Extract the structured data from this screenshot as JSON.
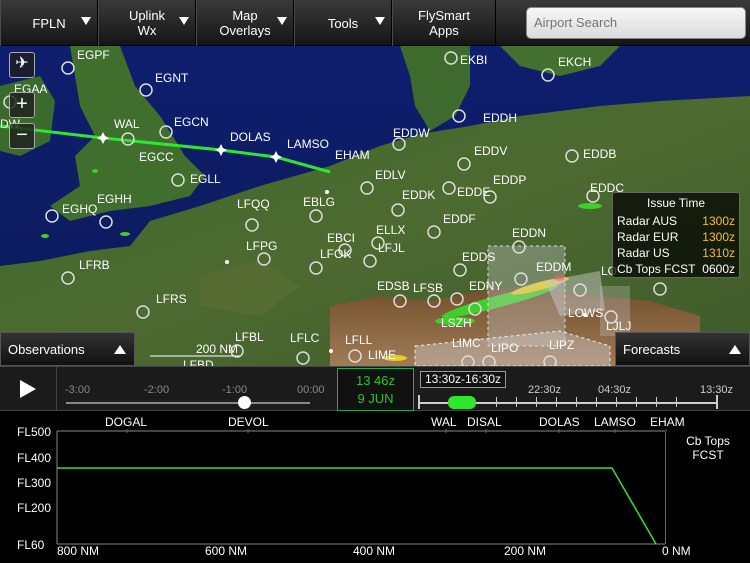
{
  "toolbar": {
    "fpln": "FPLN",
    "uplink_line1": "Uplink",
    "uplink_line2": "Wx",
    "overlays_line1": "Map",
    "overlays_line2": "Overlays",
    "tools": "Tools",
    "flysmart_line1": "FlySmart",
    "flysmart_line2": "Apps",
    "search_placeholder": "Airport Search"
  },
  "map": {
    "scale": "200 NM",
    "route_waypoints": [
      "WAL",
      "DOLAS",
      "LAMSO",
      "EHAM"
    ],
    "airports": [
      "EGPF",
      "EGNT",
      "EGAA",
      "EKBI",
      "EKCH",
      "EGCN",
      "EGCC",
      "EGLL",
      "EGHH",
      "EGHQ",
      "EDDW",
      "EDDH",
      "EDDV",
      "EDDB",
      "EDLV",
      "EDDP",
      "EDDC",
      "EDDK",
      "EDDE",
      "EDDF",
      "EDDN",
      "LFQQ",
      "EBLG",
      "EBCI",
      "ELLX",
      "LFPG",
      "LFOK",
      "LFJL",
      "EDDS",
      "EDDM",
      "LFRB",
      "LFRS",
      "EDSB",
      "LFSB",
      "EDNY",
      "LSZH",
      "LOWS",
      "LJLJ",
      "LFBL",
      "LFLC",
      "LFLL",
      "LIMC",
      "LIPO",
      "LIPZ",
      "LIME",
      "LFBD",
      "LOWW"
    ],
    "fix_labels": [
      "WAL",
      "DOLAS",
      "LAMSO",
      "EHAM",
      "EGCN",
      "EDDW"
    ],
    "partial_labels": [
      "DW",
      "LO"
    ]
  },
  "issue_time": {
    "title": "Issue Time",
    "rows": [
      {
        "label": "Radar AUS",
        "value": "1300z"
      },
      {
        "label": "Radar EUR",
        "value": "1300z"
      },
      {
        "label": "Radar US",
        "value": "1310z"
      },
      {
        "label": "Cb Tops FCST",
        "value": "0600z"
      }
    ]
  },
  "panels": {
    "observations": "Observations",
    "forecasts": "Forecasts"
  },
  "timeline": {
    "past_ticks": [
      "-3:00",
      "-2:00",
      "-1:00",
      "00:00"
    ],
    "current_time": "13 46z",
    "current_date": "9 JUN",
    "forecast_range": "13:30z-16:30z",
    "forecast_ticks": [
      "22:30z",
      "04:30z",
      "13:30z"
    ],
    "slider_fraction": 0.73
  },
  "profile": {
    "flight_levels": [
      "FL500",
      "FL400",
      "FL300",
      "FL200",
      "FL60"
    ],
    "waypoints": [
      "DOGAL",
      "DEVOL",
      "WAL",
      "DISAL",
      "DOLAS",
      "LAMSO",
      "EHAM"
    ],
    "distances": [
      "800 NM",
      "600 NM",
      "400 NM",
      "200 NM",
      "0 NM"
    ],
    "cb_label": "Cb Tops FCST"
  },
  "colors": {
    "route": "#2ee62e",
    "accent_yellow": "#f3c021",
    "clock_green": "#2ec02e"
  }
}
